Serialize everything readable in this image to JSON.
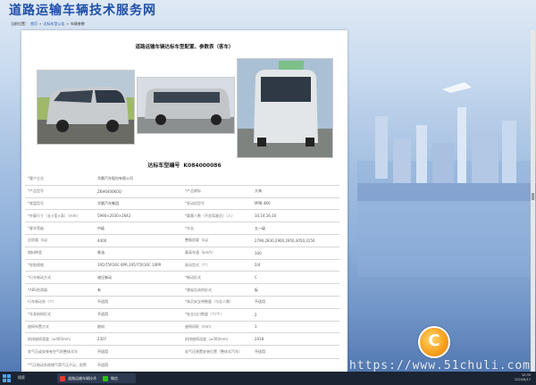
{
  "site": {
    "title": "道路运输车辆技术服务网",
    "breadcrumb": [
      "当前位置：",
      "首页",
      "»",
      "达标车型公告",
      "»",
      "车辆参数"
    ]
  },
  "panel": {
    "title": "道路运输车辆达标车型配置、参数表（客车）",
    "record_label": "达标车型编号",
    "record_no": "K084000086"
  },
  "spec_rows": [
    [
      "*客户企业",
      "华晨汽车股份有限公司",
      "",
      ""
    ],
    [
      "*产品型号",
      "ZKH6400K0Q",
      "*产品商标",
      "大海"
    ],
    [
      "*底盘型号",
      "华晨汽车集团",
      "*发动机型号",
      "MPB 4K0"
    ],
    [
      "*外廓尺寸（长×宽×高）（mm）",
      "5990×2030×2642",
      "*载客人数（不含驾驶员）（人）",
      "10,14,16,16"
    ],
    [
      "*客车等级",
      "中级",
      "*车长",
      "五一级"
    ],
    [
      "总质量（kg）",
      "4400",
      "整备质量（kg）",
      "2790,2830,2900,2950,3050,3150"
    ],
    [
      "燃料种类",
      "柴油",
      "最高车速（km/h）",
      "100"
    ],
    [
      "*轮胎规格",
      "195/75R16C 8PR,195/75R16C 10PR",
      "驱动型式（个）",
      "2/4"
    ],
    [
      "*行车制动方式",
      "液压制动",
      "*制动形式",
      "C"
    ],
    [
      "*ABS防滑器",
      "有",
      "*悬架总成的形式",
      "板"
    ],
    [
      "行车制动系（个）",
      "不适用",
      "*乘员安全带数量（与总人数）",
      "不适用"
    ],
    [
      "*车身结构形式",
      "不适用",
      "*安全出口数量（个/个）",
      "2"
    ],
    [
      "座椅布置方式",
      "前向",
      "座椅间距（mm）",
      "1"
    ],
    [
      "前排座椅宽度（≥400mm）",
      "2307",
      "前排座椅深度（≥300mm）",
      "2418"
    ],
    [
      "发气压或安装有空气的整体式车",
      "不适用",
      "发气压装置安装位置（整体式汽车）",
      "不适用"
    ],
    [
      "*气压制动系统储气筒气压不足，报警",
      "不适用",
      "",
      ""
    ]
  ],
  "watermark": "https://www.51chuli.com",
  "badge_letter": "C",
  "taskbar": {
    "search_label": "搜索",
    "apps": [
      "道路运输车辆技术",
      "微信"
    ],
    "clock_time": "10:39",
    "clock_date": "2020/6/17"
  },
  "colors": {
    "title": "#1f4fa8",
    "badge": "#f7a220",
    "taskbar": "#1b2433"
  }
}
